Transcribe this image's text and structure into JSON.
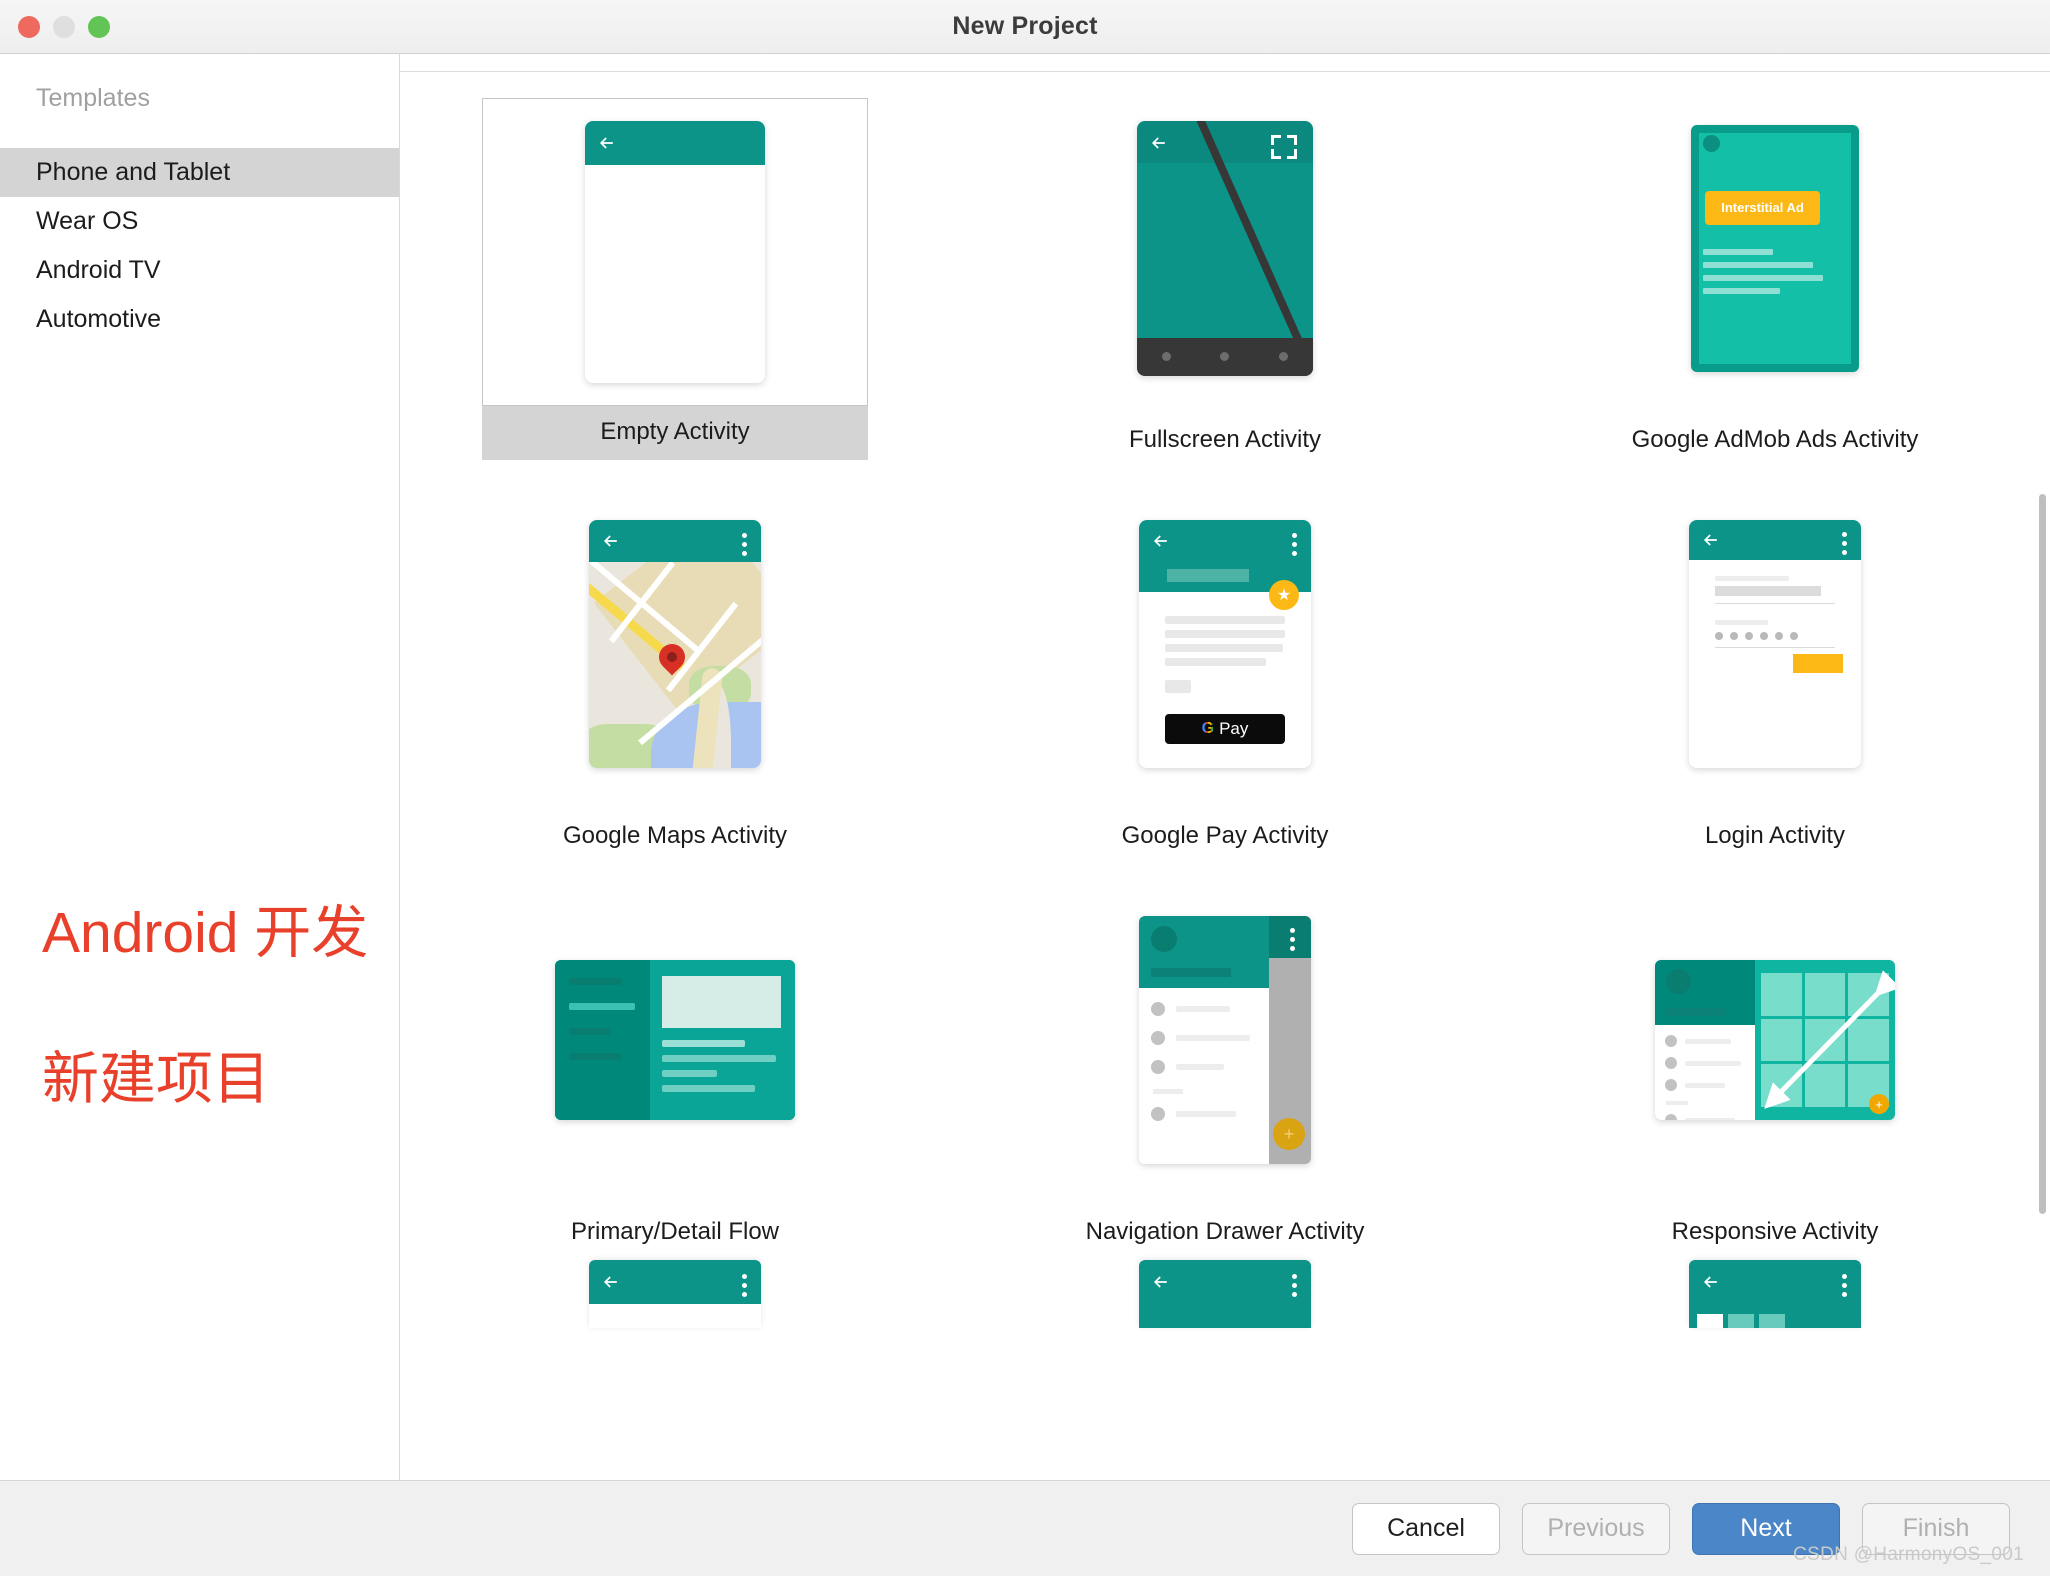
{
  "window": {
    "title": "New Project",
    "traffic_lights": [
      "close",
      "minimize",
      "zoom"
    ]
  },
  "sidebar": {
    "header": "Templates",
    "items": [
      {
        "label": "Phone and Tablet",
        "selected": true
      },
      {
        "label": "Wear OS",
        "selected": false
      },
      {
        "label": "Android TV",
        "selected": false
      },
      {
        "label": "Automotive",
        "selected": false
      }
    ]
  },
  "annotation": {
    "line1": "Android 开发",
    "line2": "新建项目",
    "color": "#e8402a"
  },
  "templates": {
    "selected": "Empty Activity",
    "items": [
      {
        "label": "Empty Activity"
      },
      {
        "label": "Fullscreen Activity"
      },
      {
        "label": "Google AdMob Ads Activity"
      },
      {
        "label": "Google Maps Activity"
      },
      {
        "label": "Google Pay Activity"
      },
      {
        "label": "Login Activity"
      },
      {
        "label": "Primary/Detail Flow"
      },
      {
        "label": "Navigation Drawer Activity"
      },
      {
        "label": "Responsive Activity"
      }
    ],
    "admob_badge": "Interstitial Ad",
    "gpay_logo": "G",
    "gpay_label": "Pay",
    "fab_plus": "+"
  },
  "footer": {
    "buttons": [
      {
        "label": "Cancel",
        "state": "enabled"
      },
      {
        "label": "Previous",
        "state": "disabled"
      },
      {
        "label": "Next",
        "state": "primary"
      },
      {
        "label": "Finish",
        "state": "disabled"
      }
    ],
    "watermark": "CSDN @HarmonyOS_001"
  },
  "colors": {
    "teal": "#0d9488",
    "teal_light": "#13bfa6",
    "yellow": "#fcb916",
    "accent_blue": "#4a86c8",
    "selection_gray": "#d4d4d4"
  }
}
